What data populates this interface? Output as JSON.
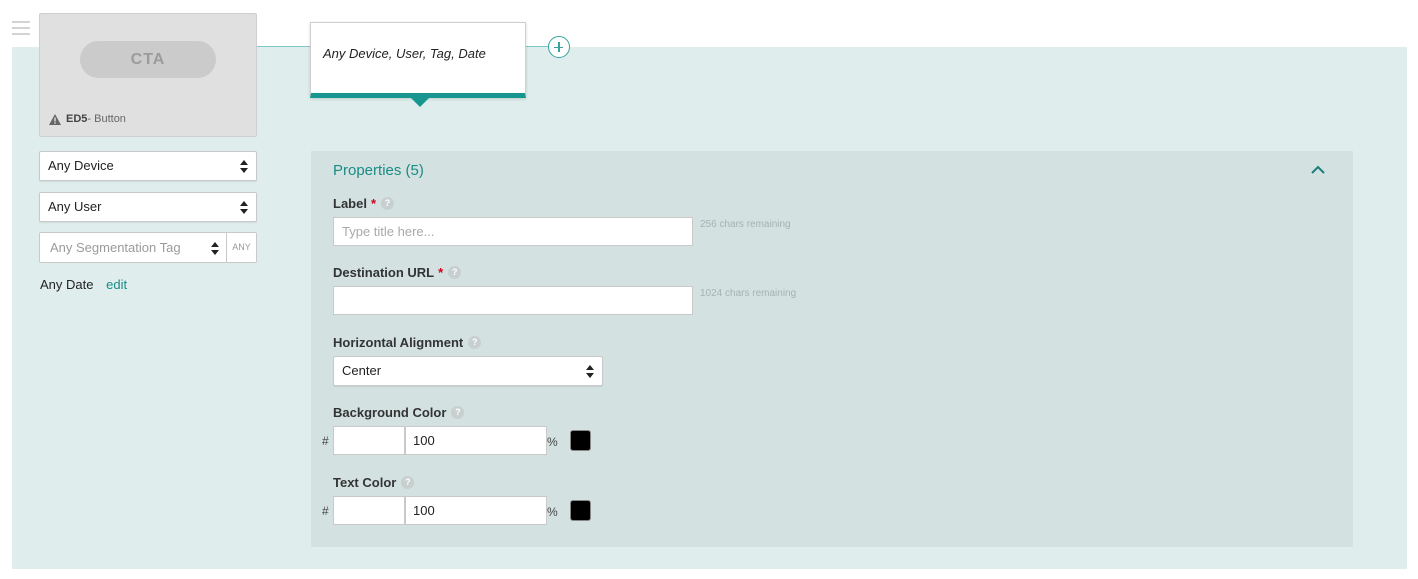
{
  "preview": {
    "cta_label": "CTA",
    "caption_code": "ED5",
    "caption_text": " - Button",
    "icon": "warning-triangle-icon"
  },
  "targeting": {
    "device": "Any Device",
    "user": "Any User",
    "segmentation_placeholder": "Any Segmentation Tag",
    "any_label": "ANY",
    "date_text": "Any Date",
    "edit_label": "edit"
  },
  "rule_card": {
    "text": "Any Device, User, Tag, Date"
  },
  "properties": {
    "title": "Properties (5)",
    "label_field": {
      "label": "Label",
      "required": "*",
      "help": "?",
      "placeholder": "Type title here...",
      "value": "",
      "remaining": "256 chars remaining"
    },
    "url_field": {
      "label": "Destination URL",
      "required": "*",
      "help": "?",
      "value": "",
      "remaining": "1024 chars remaining"
    },
    "alignment": {
      "label": "Horizontal Alignment",
      "help": "?",
      "value": "Center"
    },
    "background_color": {
      "label": "Background Color",
      "help": "?",
      "hash": "#",
      "hex": "",
      "opacity": "100",
      "pct": "%",
      "swatch": "#000000"
    },
    "text_color": {
      "label": "Text Color",
      "help": "?",
      "hash": "#",
      "hex": "",
      "opacity": "100",
      "pct": "%",
      "swatch": "#000000"
    }
  },
  "colors": {
    "accent": "#16968f",
    "canvas": "#dfeded",
    "panel": "#d3e1e1",
    "required": "#d0021b"
  }
}
